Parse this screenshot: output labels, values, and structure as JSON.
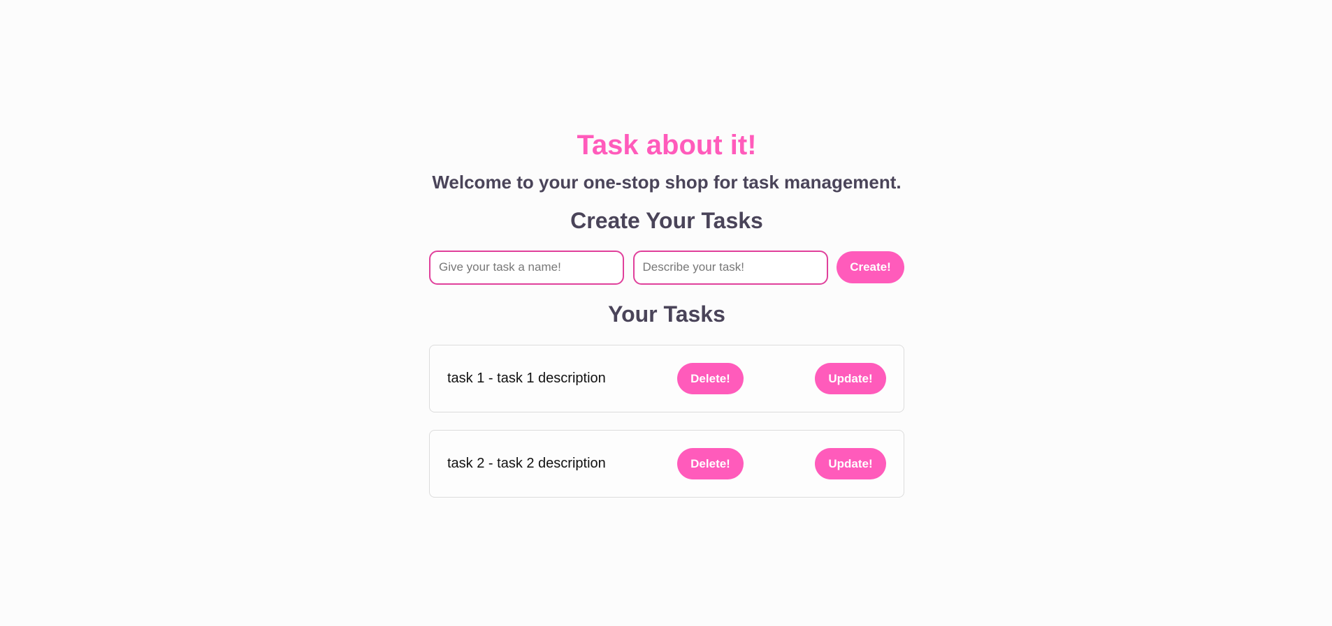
{
  "header": {
    "title": "Task about it!",
    "welcome": "Welcome to your one-stop shop for task management."
  },
  "create": {
    "heading": "Create Your Tasks",
    "name_placeholder": "Give your task a name!",
    "description_placeholder": "Describe your task!",
    "create_label": "Create!"
  },
  "tasks": {
    "heading": "Your Tasks",
    "items": [
      {
        "text": "task 1 - task 1 description",
        "delete_label": "Delete!",
        "update_label": "Update!"
      },
      {
        "text": "task 2 - task 2 description",
        "delete_label": "Delete!",
        "update_label": "Update!"
      }
    ]
  },
  "colors": {
    "accent": "#ff5bbb",
    "heading_text": "#4a4459",
    "input_border": "#e0409b",
    "background": "#fcfcfc"
  }
}
